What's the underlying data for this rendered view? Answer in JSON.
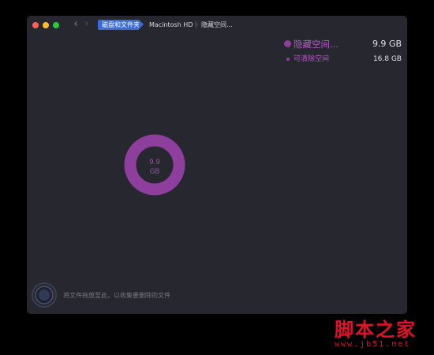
{
  "window": {
    "breadcrumbs": [
      "磁盘和文件夹",
      "Macintosh HD",
      "隐藏空间..."
    ]
  },
  "legend": [
    {
      "label": "隐藏空间...",
      "value": "9.9 GB"
    },
    {
      "label": "可清除空间",
      "value": "16.8 GB"
    }
  ],
  "donut": {
    "value": "9.9",
    "unit": "GB",
    "fill_fraction": 1.0,
    "color": "#8e3e9c"
  },
  "drop_hint": "将文件拖放至此，以收集要删除的文件",
  "watermark": {
    "main": "脚本之家",
    "sub": "www.jb51.net"
  },
  "icons": {
    "back": "chevron-left-icon",
    "forward": "chevron-right-icon",
    "drop": "drop-target-icon"
  }
}
